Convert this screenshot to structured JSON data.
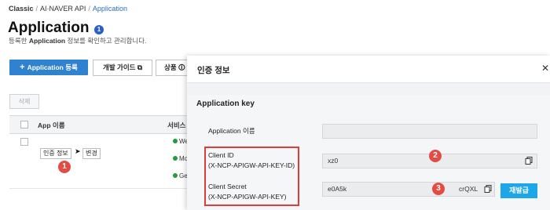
{
  "breadcrumb": {
    "root": "Classic",
    "section": "AI·NAVER API",
    "current": "Application"
  },
  "page": {
    "title": "Application",
    "title_badge": "1",
    "subtitle_prefix": "등록한",
    "subtitle_bold": "Application",
    "subtitle_suffix": "정보를 확인하고 관리합니다."
  },
  "toolbar": {
    "register_label": "Application 등록",
    "guide_label": "개발 가이드",
    "product_label": "상품 🛈",
    "delete_label": "삭제"
  },
  "table": {
    "col_app_name": "App 이름",
    "col_service": "서비스",
    "row_auth_button": "인증 정보",
    "row_edit_button": "변경",
    "services": [
      "Web",
      "Mob",
      "Geo"
    ]
  },
  "annotations": {
    "badge1": "1",
    "badge2": "2",
    "badge3": "3"
  },
  "modal": {
    "title": "인증 정보",
    "close_icon": "close-icon",
    "section_title": "Application key",
    "app_name_label": "Application 이름",
    "app_name_value": "",
    "client_id_label": "Client ID",
    "client_id_header": "(X-NCP-APIGW-API-KEY-ID)",
    "client_id_value": "xz0",
    "client_secret_label": "Client Secret",
    "client_secret_header": "(X-NCP-APIGW-API-KEY)",
    "client_secret_value_start": "e0A5k",
    "client_secret_value_end": "crQXL",
    "reissue_label": "재발급"
  },
  "colors": {
    "primary": "#2f82cf",
    "reissue": "#1ea7e8",
    "annotation_red": "#e34b43",
    "highlight_border": "#e03c3c"
  }
}
